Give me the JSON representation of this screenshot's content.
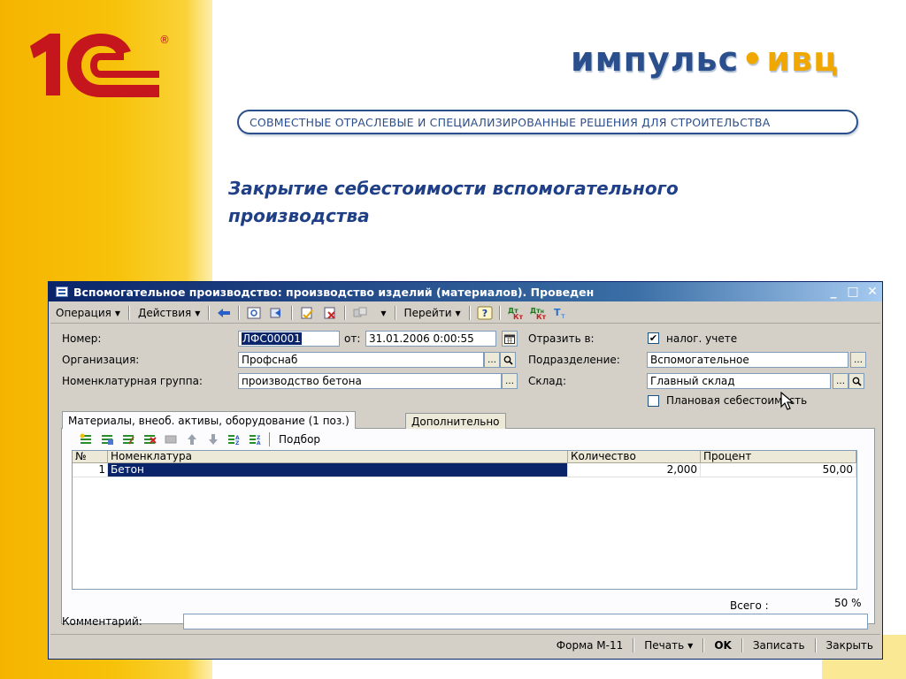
{
  "slide": {
    "logo_text": "1С",
    "brand_part1": "импульс",
    "brand_part2": "ивц",
    "tagline": "СОВМЕСТНЫЕ ОТРАСЛЕВЫЕ И СПЕЦИАЛИЗИРОВАННЫЕ РЕШЕНИЯ ДЛЯ СТРОИТЕЛЬСТВА",
    "title": "Закрытие себестоимости вспомогательного производства"
  },
  "window": {
    "title": "Вспомогательное производство: производство изделий (материалов). Проведен",
    "controls": {
      "minimize": "_",
      "maximize": "□",
      "close": "✕"
    }
  },
  "menu": {
    "operation": "Операция",
    "actions": "Действия",
    "goto": "Перейти",
    "help_icon": "question-icon"
  },
  "form": {
    "number_label": "Номер:",
    "number_value": "ЛФС00001",
    "date_label": "от:",
    "date_value": "31.01.2006  0:00:55",
    "reflect_label": "Отразить в:",
    "tax_checkbox_label": "налог. учете",
    "tax_checked": true,
    "org_label": "Организация:",
    "org_value": "Профснаб",
    "dept_label": "Подразделение:",
    "dept_value": "Вспомогательное",
    "nomgroup_label": "Номенклатурная группа:",
    "nomgroup_value": "производство бетона",
    "warehouse_label": "Склад:",
    "warehouse_value": "Главный склад",
    "plan_cost_label": "Плановая себестоимость",
    "plan_cost_checked": false
  },
  "tabs": [
    {
      "label": "Материалы, внеоб. активы, оборудование (1 поз.)",
      "active": true
    },
    {
      "label": "Дополнительно",
      "active": false
    }
  ],
  "table_toolbar": {
    "selection_label": "Подбор"
  },
  "table": {
    "columns": [
      "№",
      "Номенклатура",
      "Количество",
      "Процент"
    ],
    "rows": [
      {
        "n": "1",
        "name": "Бетон",
        "qty": "2,000",
        "percent": "50,00"
      }
    ]
  },
  "total": {
    "label": "Всего :",
    "value": "50 %"
  },
  "comment_label": "Комментарий:",
  "comment_value": "",
  "footer": {
    "form_label": "Форма М-11",
    "print": "Печать",
    "ok": "OK",
    "save": "Записать",
    "close": "Закрыть"
  },
  "colors": {
    "brand_blue": "#2a4f8c",
    "brand_orange": "#f0a800",
    "logo_red": "#c4161c",
    "title_blue": "#1f3f86",
    "band_yellow": "#f7c20a",
    "selection_navy": "#0a246a"
  }
}
